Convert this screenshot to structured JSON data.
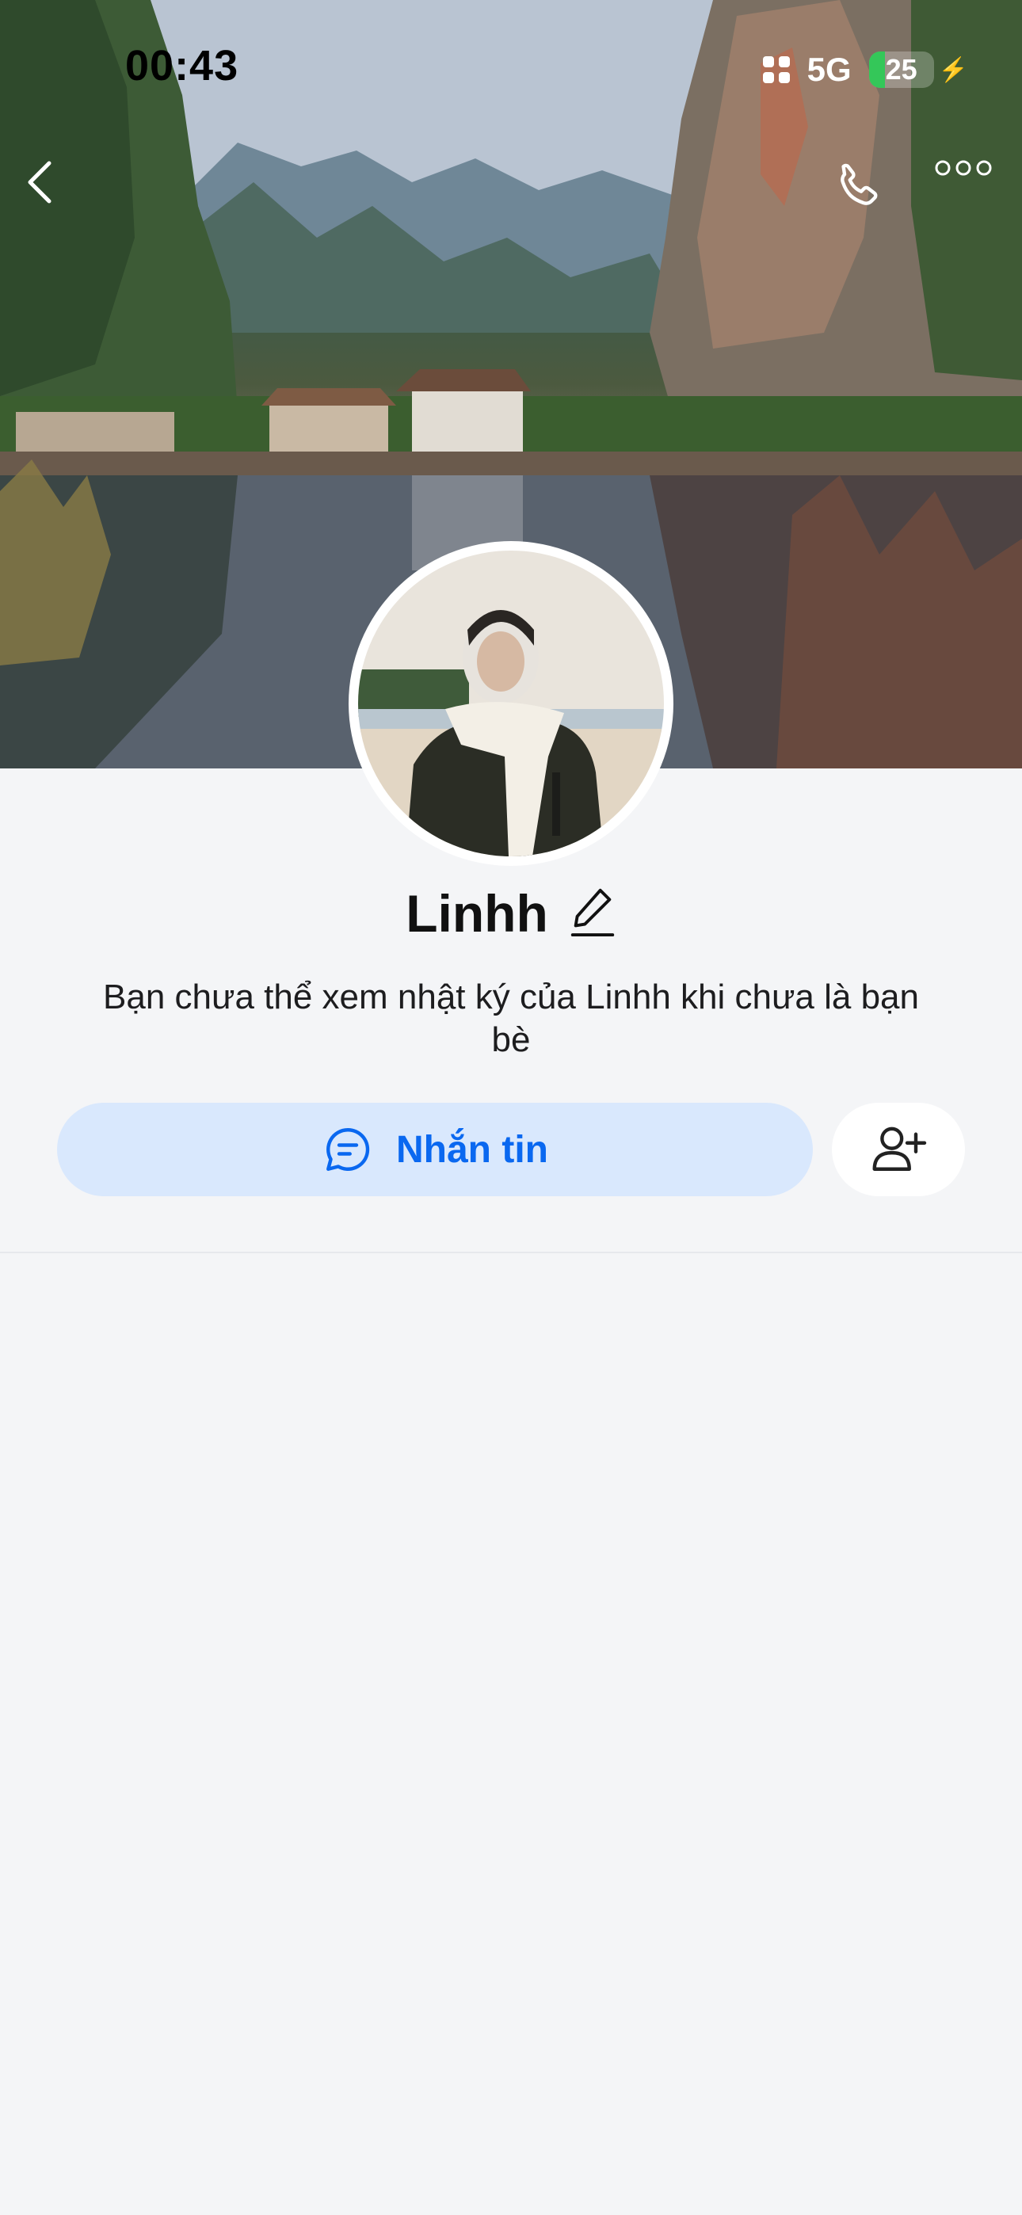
{
  "status_bar": {
    "time": "00:43",
    "network": "5G",
    "battery_level": "25",
    "battery_fraction": 0.25,
    "icons": [
      "dots-grid-icon",
      "battery-icon",
      "charging-bolt-icon"
    ]
  },
  "header": {
    "icons": [
      "back-chevron-icon",
      "phone-icon",
      "more-dots-icon"
    ]
  },
  "profile": {
    "name": "Linhh",
    "note": "Bạn chưa thể xem nhật ký của Linhh khi chưa là bạn bè"
  },
  "actions": {
    "message_label": "Nhắn tin",
    "message_icon": "chat-bubble-icon",
    "add_friend_icon": "add-friend-icon"
  },
  "colors": {
    "accent": "#0a68f0",
    "accent_bg": "#d9e8fd",
    "page_bg": "#f4f5f7",
    "battery_green": "#34c759"
  }
}
